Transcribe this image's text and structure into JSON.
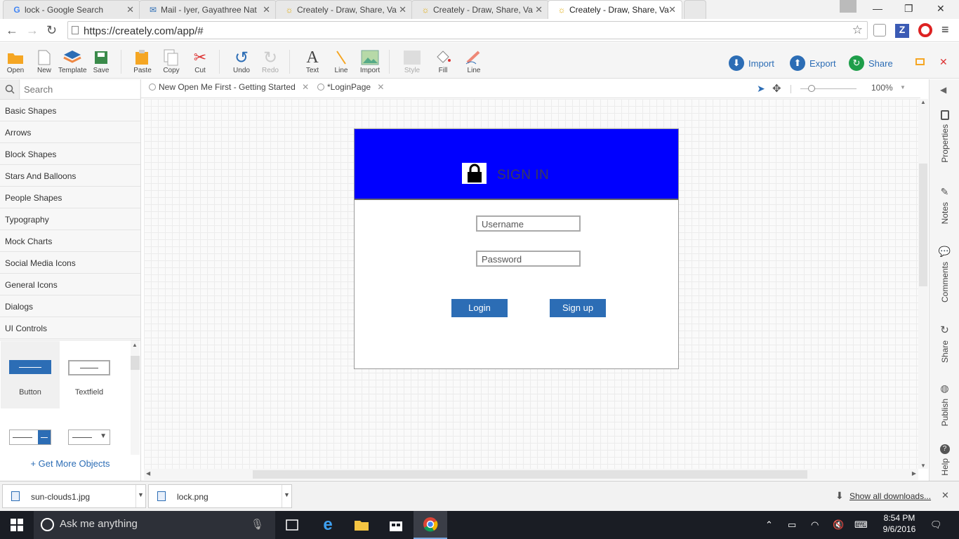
{
  "browser": {
    "tabs": [
      {
        "title": "lock - Google Search",
        "icon": "google-icon"
      },
      {
        "title": "Mail - Iyer, Gayathree Nat",
        "icon": "mail-icon"
      },
      {
        "title": "Creately - Draw, Share, Va",
        "icon": "creately-icon"
      },
      {
        "title": "Creately - Draw, Share, Va",
        "icon": "creately-icon"
      },
      {
        "title": "Creately - Draw, Share, Va",
        "icon": "creately-icon",
        "active": true
      }
    ],
    "url": "https://creately.com/app/#"
  },
  "toolbar": {
    "open": "Open",
    "new": "New",
    "template": "Template",
    "save": "Save",
    "paste": "Paste",
    "copy": "Copy",
    "cut": "Cut",
    "undo": "Undo",
    "redo": "Redo",
    "text": "Text",
    "line": "Line",
    "import_image": "Import",
    "style": "Style",
    "fill": "Fill",
    "line_style": "Line",
    "import_btn": "Import",
    "export_btn": "Export",
    "share_btn": "Share"
  },
  "library": {
    "search_placeholder": "Search",
    "categories": [
      "Basic Shapes",
      "Arrows",
      "Block Shapes",
      "Stars And Balloons",
      "People Shapes",
      "Typography",
      "Mock Charts",
      "Social Media Icons",
      "General Icons",
      "Dialogs",
      "UI Controls"
    ],
    "shapes": [
      {
        "label": "Button"
      },
      {
        "label": "Textfield"
      }
    ],
    "get_more": "+ Get More Objects"
  },
  "doc_tabs": [
    {
      "label": "New Open Me First - Getting Started"
    },
    {
      "label": "*LoginPage"
    }
  ],
  "zoom": "100%",
  "mockup": {
    "title": "SIGN IN",
    "username_placeholder": "Username",
    "password_placeholder": "Password",
    "login": "Login",
    "signup": "Sign up",
    "header_color": "#0000ff"
  },
  "right_sidebar": [
    "Properties",
    "Notes",
    "Comments",
    "Share",
    "Publish",
    "Help"
  ],
  "downloads": {
    "items": [
      "sun-clouds1.jpg",
      "lock.png"
    ],
    "show_all": "Show all downloads..."
  },
  "taskbar": {
    "search": "Ask me anything",
    "time": "8:54 PM",
    "date": "9/6/2016"
  },
  "colors": {
    "accent": "#2c6db5",
    "import_green": "#1e9e4a"
  }
}
